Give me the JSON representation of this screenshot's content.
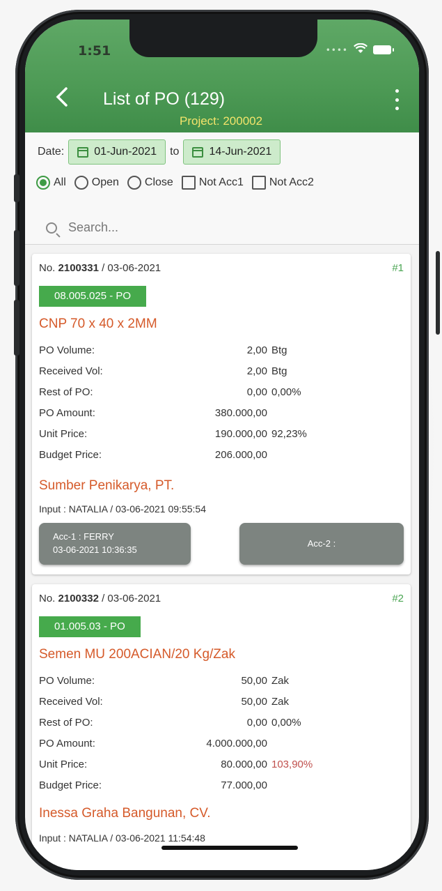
{
  "status": {
    "time": "1:51"
  },
  "header": {
    "title": "List of PO (129)",
    "project": "Project: 200002"
  },
  "filters": {
    "date_label": "Date:",
    "date_from": "01-Jun-2021",
    "to_label": "to",
    "date_to": "14-Jun-2021",
    "options": [
      {
        "label": "All",
        "type": "radio",
        "selected": true
      },
      {
        "label": "Open",
        "type": "radio",
        "selected": false
      },
      {
        "label": "Close",
        "type": "radio",
        "selected": false
      },
      {
        "label": "Not Acc1",
        "type": "checkbox",
        "checked": false
      },
      {
        "label": "Not Acc2",
        "type": "checkbox",
        "checked": false
      }
    ],
    "search_placeholder": "Search..."
  },
  "labels": {
    "po_volume": "PO Volume:",
    "received_vol": "Received Vol:",
    "rest_of_po": "Rest of PO:",
    "po_amount": "PO Amount:",
    "unit_price": "Unit Price:",
    "budget_price": "Budget Price:"
  },
  "items": [
    {
      "no_prefix": "No. ",
      "number": "2100331",
      "date": " / 03-06-2021",
      "index": "#1",
      "code": "08.005.025 - PO",
      "name": "CNP 70 x 40 x 2MM",
      "po_volume": "2,00",
      "po_volume_unit": "Btg",
      "received_vol": "2,00",
      "received_unit": "Btg",
      "rest_of_po": "0,00",
      "rest_pct": "0,00%",
      "po_amount": "380.000,00",
      "unit_price": "190.000,00",
      "price_pct": "92,23%",
      "budget_price": "206.000,00",
      "supplier": "Sumber Penikarya, PT.",
      "input": "Input : NATALIA / 03-06-2021 09:55:54",
      "acc1_line1": "Acc-1 : FERRY",
      "acc1_line2": "03-06-2021 10:36:35",
      "acc2": "Acc-2 :"
    },
    {
      "no_prefix": "No. ",
      "number": "2100332",
      "date": " / 03-06-2021",
      "index": "#2",
      "code": "01.005.03 - PO",
      "name": "Semen MU 200ACIAN/20 Kg/Zak",
      "po_volume": "50,00",
      "po_volume_unit": "Zak",
      "received_vol": "50,00",
      "received_unit": "Zak",
      "rest_of_po": "0,00",
      "rest_pct": "0,00%",
      "po_amount": "4.000.000,00",
      "unit_price": "80.000,00",
      "price_pct": "103,90%",
      "budget_price": "77.000,00",
      "supplier": "Inessa Graha Bangunan, CV.",
      "input": "Input : NATALIA / 03-06-2021 11:54:48"
    }
  ]
}
